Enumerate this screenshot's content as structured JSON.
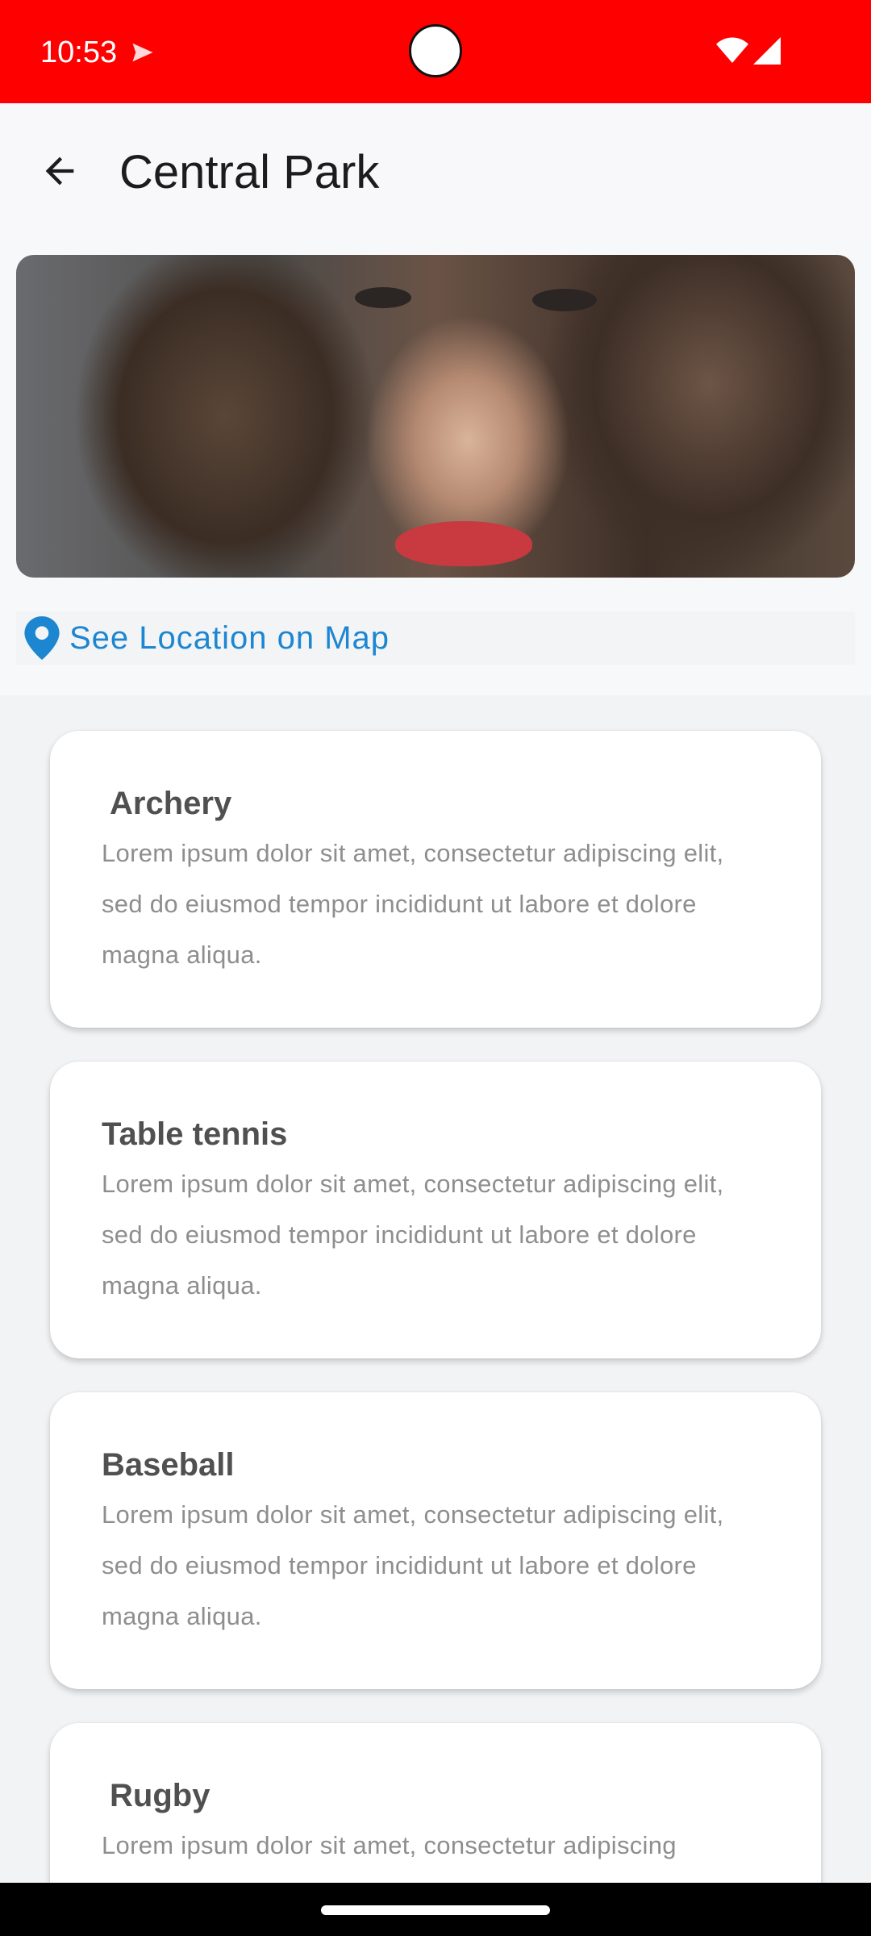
{
  "status_bar": {
    "time": "10:53",
    "background_color": "#ff0000",
    "icons": [
      "send-icon",
      "wifi-icon",
      "signal-icon"
    ]
  },
  "app_bar": {
    "title": "Central Park",
    "back_icon": "arrow-back-icon"
  },
  "hero": {
    "icon": "photo"
  },
  "location": {
    "label": "See Location on Map",
    "icon": "location-pin-icon",
    "color": "#1d86d1"
  },
  "activities": [
    {
      "title": "Archery",
      "description": "Lorem ipsum dolor sit amet, consectetur adipiscing elit, sed do eiusmod tempor incididunt ut labore et dolore magna aliqua."
    },
    {
      "title": "Table tennis",
      "description": "Lorem ipsum dolor sit amet, consectetur adipiscing elit, sed do eiusmod tempor incididunt ut labore et dolore magna aliqua."
    },
    {
      "title": "Baseball",
      "description": "Lorem ipsum dolor sit amet, consectetur adipiscing elit, sed do eiusmod tempor incididunt ut labore et dolore magna aliqua."
    },
    {
      "title": "Rugby",
      "description": "Lorem ipsum dolor sit amet, consectetur adipiscing"
    }
  ]
}
